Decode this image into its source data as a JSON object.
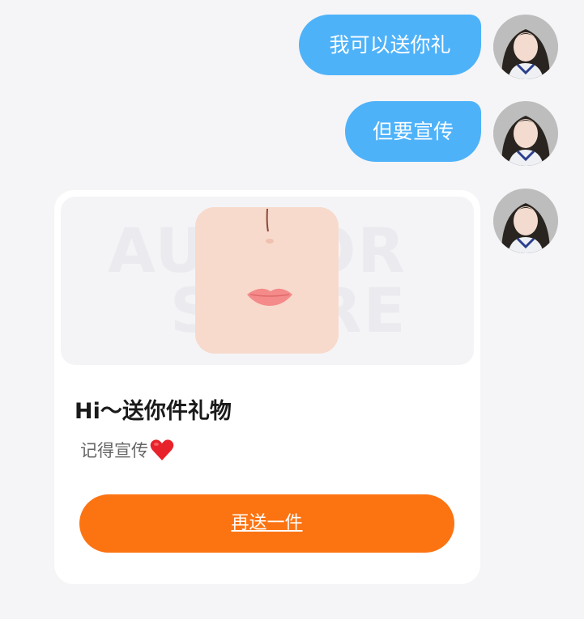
{
  "messages": [
    {
      "text": "我可以送你礼"
    },
    {
      "text": "但要宣传"
    }
  ],
  "gift_card": {
    "watermark_line1": "AUTHOR",
    "watermark_line2": "SUPRE",
    "title": "Hi～送你件礼物",
    "subtitle": "记得宣传",
    "subtitle_icon": "heart-icon",
    "button_label": "再送一件"
  },
  "colors": {
    "bubble": "#4eb2f9",
    "button": "#fc7412",
    "background": "#f5f5f7"
  }
}
